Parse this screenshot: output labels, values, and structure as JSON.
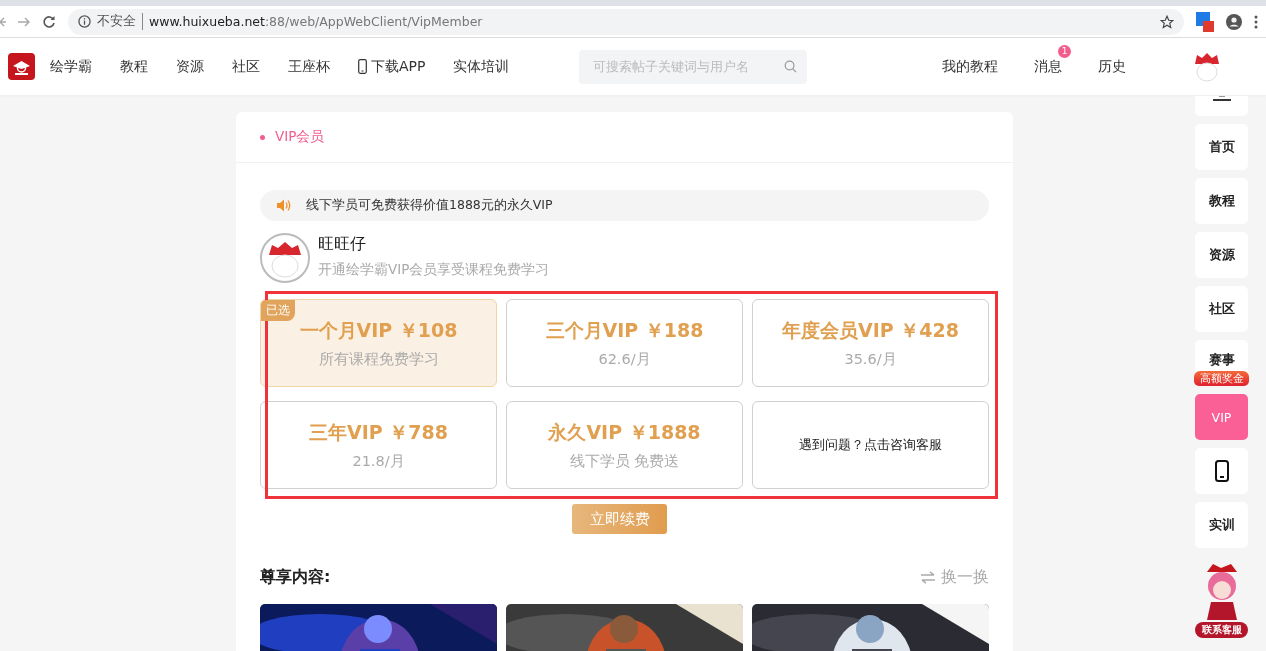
{
  "browser": {
    "security": "不安全",
    "url_host": "www.huixueba.net",
    "url_path": ":88/web/AppWebClient/VipMember"
  },
  "nav": {
    "items": [
      {
        "label": "绘学霸",
        "kind": "text"
      },
      {
        "label": "教程",
        "kind": "text"
      },
      {
        "label": "资源",
        "kind": "text"
      },
      {
        "label": "社区",
        "kind": "text"
      },
      {
        "label": "王座杯",
        "kind": "text"
      },
      {
        "label": "下载APP",
        "kind": "phone"
      },
      {
        "label": "实体培训",
        "kind": "text"
      }
    ],
    "search": {
      "placeholder": "可搜索帖子关键词与用户名"
    },
    "right": [
      {
        "label": "我的教程"
      },
      {
        "label": "消息",
        "badge": "1"
      },
      {
        "label": "历史"
      }
    ]
  },
  "breadcrumb": "VIP会员",
  "notice": "线下学员可免费获得价值1888元的永久VIP",
  "user": {
    "name": "旺旺仔",
    "subtitle": "开通绘学霸VIP会员享受课程免费学习"
  },
  "plans": [
    {
      "kind": "plan",
      "title": "一个月VIP ￥108",
      "sub": "所有课程免费学习",
      "selected": true,
      "tag": "已选"
    },
    {
      "kind": "plan",
      "title": "三个月VIP ￥188",
      "sub": "62.6/月",
      "selected": false
    },
    {
      "kind": "plan",
      "title": "年度会员VIP ￥428",
      "sub": "35.6/月",
      "selected": false
    },
    {
      "kind": "plan",
      "title": "三年VIP ￥788",
      "sub": "21.8/月",
      "selected": false
    },
    {
      "kind": "plan",
      "title": "永久VIP ￥1888",
      "sub": "线下学员 免费送",
      "selected": false
    },
    {
      "kind": "help",
      "title": "遇到问题？点击咨询客服"
    }
  ],
  "renew_button": "立即续费",
  "section": {
    "title": "尊享内容:",
    "refresh": "换一换"
  },
  "sidebar": [
    {
      "kind": "text",
      "label": "首页",
      "selected": false
    },
    {
      "kind": "text",
      "label": "教程",
      "selected": false
    },
    {
      "kind": "text",
      "label": "资源",
      "selected": false
    },
    {
      "kind": "text",
      "label": "社区",
      "selected": false
    },
    {
      "kind": "badge",
      "label": "赛事",
      "badge": "高额奖金",
      "selected": false
    },
    {
      "kind": "text",
      "label": "VIP",
      "selected": true
    },
    {
      "kind": "phone",
      "selected": false
    },
    {
      "kind": "text",
      "label": "实训",
      "selected": false
    }
  ],
  "service_label": "联系客服"
}
